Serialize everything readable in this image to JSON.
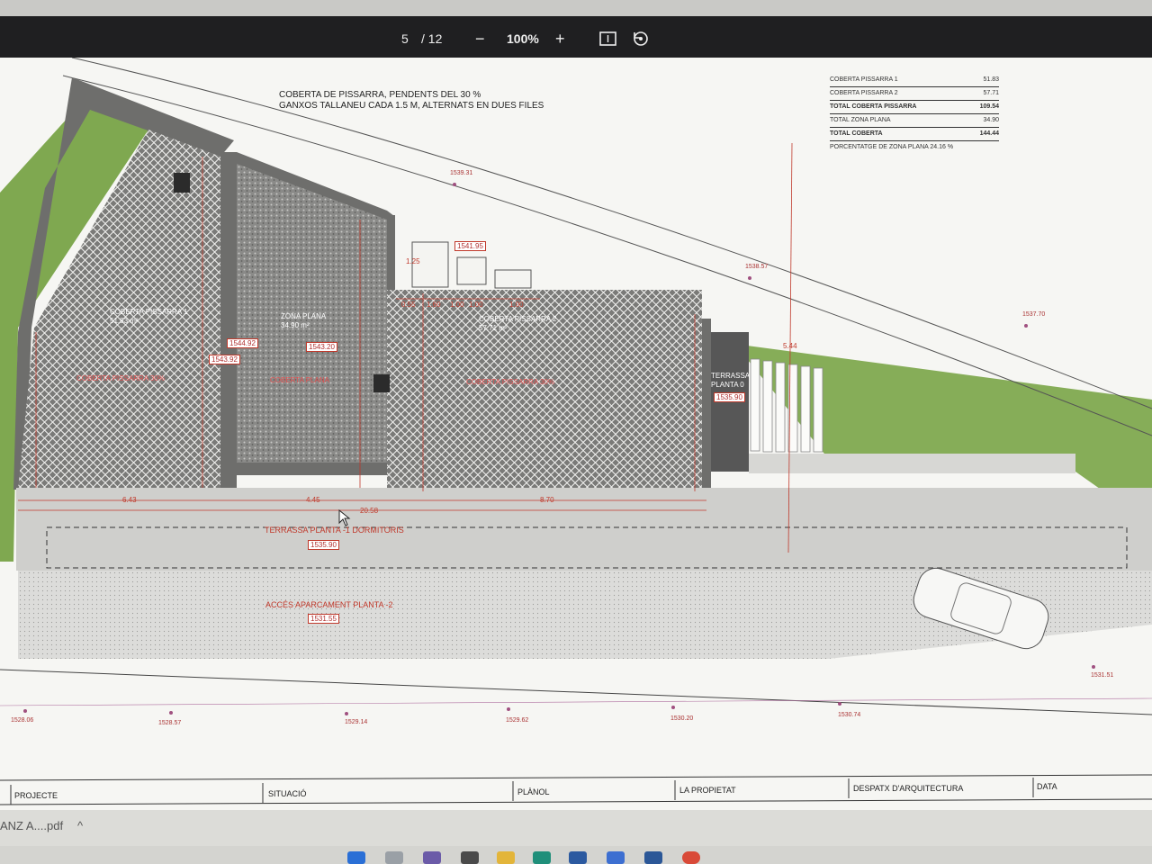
{
  "viewer": {
    "page_current": "5",
    "page_total": "/ 12",
    "zoom": "100%",
    "zoom_out": "−",
    "zoom_in": "+"
  },
  "plan": {
    "note_line1": "COBERTA DE PISSARRA, PENDENTS DEL 30 %",
    "note_line2": "GANXOS TALLANEU CADA 1.5 M, ALTERNATS EN DUES FILES",
    "areas": {
      "pissarra1_title": "COBERTA  PISSARRA 1",
      "pissarra1_area": "51.83 m²",
      "pissarra1_slope": "COBERTA PISSARRA 30%",
      "plana_title": "ZONA PLANA",
      "plana_area": "34.90 m²",
      "plana_label": "COBERTA PLANA",
      "pissarra2_title": "COBERTA  PISSARRA 2",
      "pissarra2_area": "57.71 m²",
      "pissarra2_slope": "COBERTA PISSARRA 30%",
      "terrassa0_line1": "TERRASSA",
      "terrassa0_line2": "PLANTA 0",
      "terrassa1": "TERRASSA PLANTA -1 DORMITORIS",
      "acces": "ACCÉS APARCAMENT PLANTA -2"
    },
    "levels": {
      "l1543_20": "1543.20",
      "l1544_92": "1544.92",
      "l1543_92": "1543.92",
      "l1541_95": "1541.95",
      "l1535_90a": "1535.90",
      "l1535_90b": "1535.90",
      "l1531_55": "1531.55"
    },
    "elevations": [
      "1539.31",
      "1538.57",
      "1537.70",
      "1528.06",
      "1528.57",
      "1529.14",
      "1529.62",
      "1530.20",
      "1530.74",
      "1531.51"
    ],
    "dims": [
      "6.43",
      "4.45",
      "8.70",
      "20.58",
      "1.60",
      "1.00",
      "1.00",
      "1.00",
      "0.55",
      "5.44",
      "1.25"
    ]
  },
  "stats": {
    "rows": [
      {
        "label": "COBERTA  PISSARRA 1",
        "value": "51.83"
      },
      {
        "label": "COBERTA PISSARRA 2",
        "value": "57.71"
      },
      {
        "label": "TOTAL COBERTA PISSARRA",
        "value": "109.54"
      },
      {
        "label": "TOTAL ZONA PLANA",
        "value": "34.90"
      },
      {
        "label": "TOTAL COBERTA",
        "value": "144.44"
      }
    ],
    "footnote": "PORCENTATGE DE ZONA PLANA  24.16 %"
  },
  "titleblock": {
    "projecte": "PROJECTE",
    "situacio": "SITUACIÓ",
    "planol": "PLÀNOL",
    "propietat": "LA PROPIETAT",
    "despatx": "DESPATX D'ARQUITECTURA",
    "data": "DATA"
  },
  "download": {
    "filename": "ANZ A....pdf",
    "chevron": "^"
  },
  "colors": {
    "toolbar": "#1f1f21",
    "grass": "#7fa850",
    "wall": "#6e6e6c",
    "dimension": "#c0392b"
  }
}
